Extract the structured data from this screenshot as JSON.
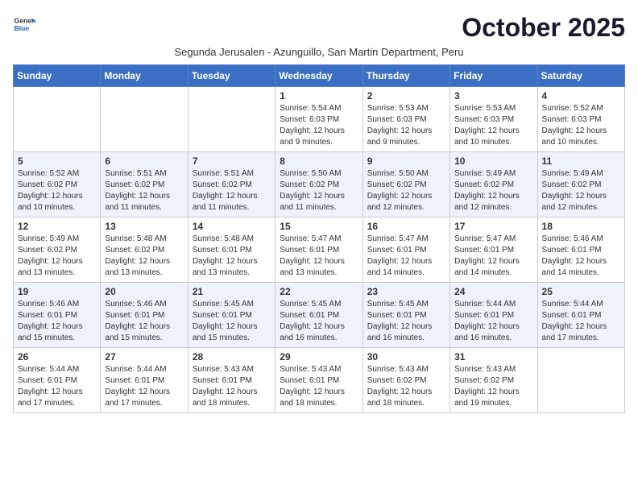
{
  "logo": {
    "general": "General",
    "blue": "Blue"
  },
  "title": "October 2025",
  "subtitle": "Segunda Jerusalen - Azunguillo, San Martin Department, Peru",
  "days_of_week": [
    "Sunday",
    "Monday",
    "Tuesday",
    "Wednesday",
    "Thursday",
    "Friday",
    "Saturday"
  ],
  "weeks": [
    [
      {
        "day": "",
        "info": ""
      },
      {
        "day": "",
        "info": ""
      },
      {
        "day": "",
        "info": ""
      },
      {
        "day": "1",
        "info": "Sunrise: 5:54 AM\nSunset: 6:03 PM\nDaylight: 12 hours and 9 minutes."
      },
      {
        "day": "2",
        "info": "Sunrise: 5:53 AM\nSunset: 6:03 PM\nDaylight: 12 hours and 9 minutes."
      },
      {
        "day": "3",
        "info": "Sunrise: 5:53 AM\nSunset: 6:03 PM\nDaylight: 12 hours and 10 minutes."
      },
      {
        "day": "4",
        "info": "Sunrise: 5:52 AM\nSunset: 6:03 PM\nDaylight: 12 hours and 10 minutes."
      }
    ],
    [
      {
        "day": "5",
        "info": "Sunrise: 5:52 AM\nSunset: 6:02 PM\nDaylight: 12 hours and 10 minutes."
      },
      {
        "day": "6",
        "info": "Sunrise: 5:51 AM\nSunset: 6:02 PM\nDaylight: 12 hours and 11 minutes."
      },
      {
        "day": "7",
        "info": "Sunrise: 5:51 AM\nSunset: 6:02 PM\nDaylight: 12 hours and 11 minutes."
      },
      {
        "day": "8",
        "info": "Sunrise: 5:50 AM\nSunset: 6:02 PM\nDaylight: 12 hours and 11 minutes."
      },
      {
        "day": "9",
        "info": "Sunrise: 5:50 AM\nSunset: 6:02 PM\nDaylight: 12 hours and 12 minutes."
      },
      {
        "day": "10",
        "info": "Sunrise: 5:49 AM\nSunset: 6:02 PM\nDaylight: 12 hours and 12 minutes."
      },
      {
        "day": "11",
        "info": "Sunrise: 5:49 AM\nSunset: 6:02 PM\nDaylight: 12 hours and 12 minutes."
      }
    ],
    [
      {
        "day": "12",
        "info": "Sunrise: 5:49 AM\nSunset: 6:02 PM\nDaylight: 12 hours and 13 minutes."
      },
      {
        "day": "13",
        "info": "Sunrise: 5:48 AM\nSunset: 6:02 PM\nDaylight: 12 hours and 13 minutes."
      },
      {
        "day": "14",
        "info": "Sunrise: 5:48 AM\nSunset: 6:01 PM\nDaylight: 12 hours and 13 minutes."
      },
      {
        "day": "15",
        "info": "Sunrise: 5:47 AM\nSunset: 6:01 PM\nDaylight: 12 hours and 13 minutes."
      },
      {
        "day": "16",
        "info": "Sunrise: 5:47 AM\nSunset: 6:01 PM\nDaylight: 12 hours and 14 minutes."
      },
      {
        "day": "17",
        "info": "Sunrise: 5:47 AM\nSunset: 6:01 PM\nDaylight: 12 hours and 14 minutes."
      },
      {
        "day": "18",
        "info": "Sunrise: 5:46 AM\nSunset: 6:01 PM\nDaylight: 12 hours and 14 minutes."
      }
    ],
    [
      {
        "day": "19",
        "info": "Sunrise: 5:46 AM\nSunset: 6:01 PM\nDaylight: 12 hours and 15 minutes."
      },
      {
        "day": "20",
        "info": "Sunrise: 5:46 AM\nSunset: 6:01 PM\nDaylight: 12 hours and 15 minutes."
      },
      {
        "day": "21",
        "info": "Sunrise: 5:45 AM\nSunset: 6:01 PM\nDaylight: 12 hours and 15 minutes."
      },
      {
        "day": "22",
        "info": "Sunrise: 5:45 AM\nSunset: 6:01 PM\nDaylight: 12 hours and 16 minutes."
      },
      {
        "day": "23",
        "info": "Sunrise: 5:45 AM\nSunset: 6:01 PM\nDaylight: 12 hours and 16 minutes."
      },
      {
        "day": "24",
        "info": "Sunrise: 5:44 AM\nSunset: 6:01 PM\nDaylight: 12 hours and 16 minutes."
      },
      {
        "day": "25",
        "info": "Sunrise: 5:44 AM\nSunset: 6:01 PM\nDaylight: 12 hours and 17 minutes."
      }
    ],
    [
      {
        "day": "26",
        "info": "Sunrise: 5:44 AM\nSunset: 6:01 PM\nDaylight: 12 hours and 17 minutes."
      },
      {
        "day": "27",
        "info": "Sunrise: 5:44 AM\nSunset: 6:01 PM\nDaylight: 12 hours and 17 minutes."
      },
      {
        "day": "28",
        "info": "Sunrise: 5:43 AM\nSunset: 6:01 PM\nDaylight: 12 hours and 18 minutes."
      },
      {
        "day": "29",
        "info": "Sunrise: 5:43 AM\nSunset: 6:01 PM\nDaylight: 12 hours and 18 minutes."
      },
      {
        "day": "30",
        "info": "Sunrise: 5:43 AM\nSunset: 6:02 PM\nDaylight: 12 hours and 18 minutes."
      },
      {
        "day": "31",
        "info": "Sunrise: 5:43 AM\nSunset: 6:02 PM\nDaylight: 12 hours and 19 minutes."
      },
      {
        "day": "",
        "info": ""
      }
    ]
  ]
}
